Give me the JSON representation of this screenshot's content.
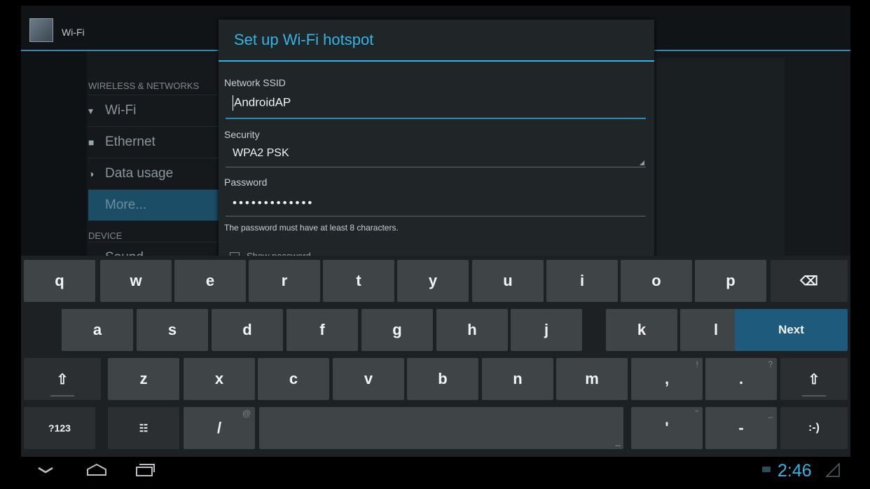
{
  "app": {
    "title": "Wi-Fi"
  },
  "settings": {
    "category_wireless": "WIRELESS & NETWORKS",
    "items": [
      {
        "label": "Wi-Fi",
        "icon": "wifi-icon"
      },
      {
        "label": "Ethernet",
        "icon": "ethernet-icon"
      },
      {
        "label": "Data usage",
        "icon": "data-usage-icon"
      },
      {
        "label": "More...",
        "icon": ""
      }
    ],
    "category_device": "DEVICE",
    "partial_item": "Sound"
  },
  "dialog": {
    "title": "Set up Wi-Fi hotspot",
    "ssid_label": "Network SSID",
    "ssid_value": "AndroidAP",
    "security_label": "Security",
    "security_value": "WPA2 PSK",
    "password_label": "Password",
    "password_value": "•••••••••••••",
    "hint": "The password must have at least 8 characters.",
    "show_password": "Show password"
  },
  "keyboard": {
    "row1": [
      "q",
      "w",
      "e",
      "r",
      "t",
      "y",
      "u",
      "i",
      "o",
      "p"
    ],
    "row2": [
      "a",
      "s",
      "d",
      "f",
      "g",
      "h",
      "j",
      "k",
      "l"
    ],
    "row3": [
      "z",
      "x",
      "c",
      "v",
      "b",
      "n",
      "m"
    ],
    "next_label": "Next",
    "sym_label": "?123",
    "slash": "/",
    "slash_alt": "@",
    "comma": ",",
    "comma_alt": "!",
    "period": ".",
    "period_alt": "?",
    "apostrophe": "'",
    "apostrophe_alt": "\"",
    "dash": "-",
    "dash_alt": "_",
    "smiley": ":-)",
    "space_dots": "..."
  },
  "status": {
    "time": "2:46"
  },
  "colors": {
    "accent": "#33b5e5",
    "next_key": "#1e5a7c",
    "key": "#3f4447"
  }
}
